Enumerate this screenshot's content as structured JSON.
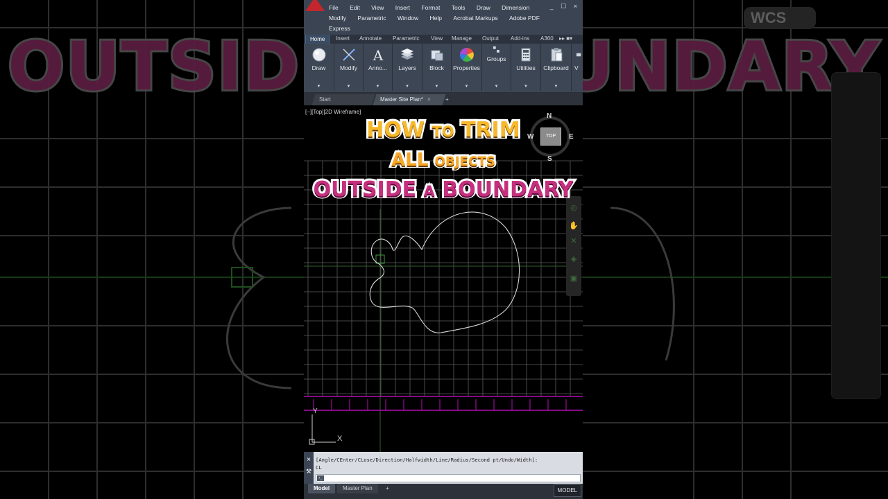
{
  "menubar": {
    "items": [
      "File",
      "Edit",
      "View",
      "Insert",
      "Format",
      "Tools",
      "Draw",
      "Dimension",
      "Modify",
      "Parametric",
      "Window",
      "Help",
      "Acrobat Markups",
      "Adobe PDF",
      "Express"
    ],
    "window_controls": "_ ☐ ×"
  },
  "ribbon_tabs": [
    "Home",
    "Insert",
    "Annotate",
    "Parametric",
    "View",
    "Manage",
    "Output",
    "Add-ins",
    "A360"
  ],
  "ribbon_tabs_more": "▸▸ ■▾",
  "ribbon_panels": {
    "draw": "Draw",
    "modify": "Modify",
    "annotation": "Anno...",
    "layers": "Layers",
    "block": "Block",
    "properties": "Properties",
    "groups": "Groups",
    "utilities": "Utilities",
    "clipboard": "Clipboard",
    "view": "V"
  },
  "doc_tabs": {
    "start": "Start",
    "current": "Master Site Plan*",
    "close": "×",
    "add": "+"
  },
  "viewport_label": "[−][Top][2D Wireframe]",
  "overlay": {
    "l1a": "HOW",
    "l1b": "TO",
    "l1c": "TRIM",
    "l2a": "ALL",
    "l2b": "OBJECTS",
    "l3a": "OUTSIDE",
    "l3b": "A",
    "l3c": "BOUNDARY"
  },
  "viewcube": {
    "north": "N",
    "south": "S",
    "east": "E",
    "west": "W",
    "face": "TOP"
  },
  "ucs": {
    "x": "X",
    "y": "Y"
  },
  "command_line": {
    "line1": "[Angle/CEnter/CLose/Direction/Halfwidth/Line/Radius/Second pt/Undo/Width]:",
    "line2": "CL",
    "input_value": "",
    "close_icon": "×",
    "settings_icon": "wrench-icon"
  },
  "layout_tabs": {
    "model": "Model",
    "plan": "Master Plan",
    "add": "+"
  },
  "status": {
    "model": "MODEL"
  },
  "background": {
    "title": "OUTSIDE A BOUNDARY",
    "wcs": "WCS"
  },
  "colors": {
    "ribbon": "#3d4654",
    "menubar": "#3b4453",
    "grid": "#5e5e5e",
    "fence": "#b30fb3",
    "title_orange": "#f7b82a",
    "title_pink": "#c52f7e"
  }
}
